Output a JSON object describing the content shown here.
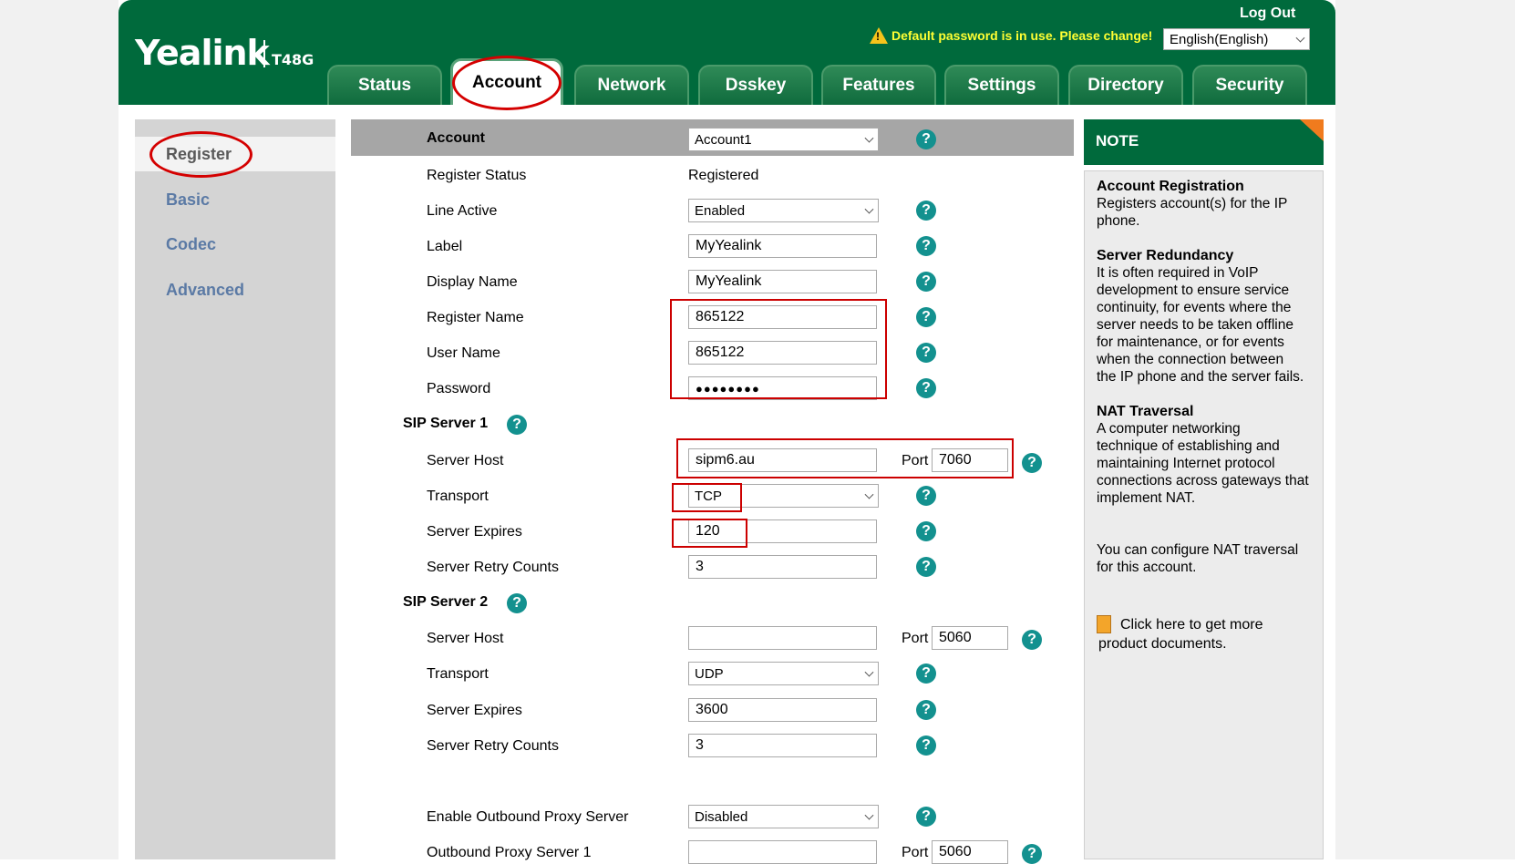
{
  "header": {
    "logo": "Yealink",
    "model": "T48G",
    "logout": "Log Out",
    "warning": "Default password is in use. Please change!",
    "language": "English(English)"
  },
  "tabs": [
    "Status",
    "Account",
    "Network",
    "Dsskey",
    "Features",
    "Settings",
    "Directory",
    "Security"
  ],
  "active_tab": "Account",
  "sidebar": {
    "items": [
      "Register",
      "Basic",
      "Codec",
      "Advanced"
    ],
    "active": "Register"
  },
  "form": {
    "account": {
      "label": "Account",
      "value": "Account1"
    },
    "register_status": {
      "label": "Register Status",
      "value": "Registered"
    },
    "line_active": {
      "label": "Line Active",
      "value": "Enabled"
    },
    "label_field": {
      "label": "Label",
      "value": "MyYealink"
    },
    "display_name": {
      "label": "Display Name",
      "value": "MyYealink"
    },
    "register_name": {
      "label": "Register Name",
      "value": "865122"
    },
    "user_name": {
      "label": "User Name",
      "value": "865122"
    },
    "password": {
      "label": "Password",
      "value": "●●●●●●●●"
    },
    "sip1": {
      "title": "SIP Server 1",
      "host_label": "Server Host",
      "host": "sipm6.au",
      "port_label": "Port",
      "port": "7060",
      "transport_label": "Transport",
      "transport": "TCP",
      "expires_label": "Server Expires",
      "expires": "120",
      "retry_label": "Server Retry Counts",
      "retry": "3"
    },
    "sip2": {
      "title": "SIP Server 2",
      "host_label": "Server Host",
      "host": "",
      "port_label": "Port",
      "port": "5060",
      "transport_label": "Transport",
      "transport": "UDP",
      "expires_label": "Server Expires",
      "expires": "3600",
      "retry_label": "Server Retry Counts",
      "retry": "3"
    },
    "outbound": {
      "label": "Enable Outbound Proxy Server",
      "value": "Disabled"
    },
    "outbound1": {
      "label": "Outbound Proxy Server 1",
      "value": "",
      "port_label": "Port",
      "port": "5060"
    }
  },
  "note": {
    "title": "NOTE",
    "sections": [
      {
        "title": "Account Registration",
        "lines": [
          "Registers account(s) for the IP",
          "phone."
        ]
      },
      {
        "title": "Server Redundancy",
        "lines": [
          "It is often required in VoIP",
          "development to ensure service",
          "continuity, for events where the",
          "server needs to be taken offline",
          "for maintenance, or for events",
          "when the connection between",
          "the IP phone and the server fails."
        ]
      },
      {
        "title": "NAT Traversal",
        "lines": [
          "A computer networking",
          "technique of establishing and",
          "maintaining Internet protocol",
          "connections across gateways that",
          "implement NAT."
        ]
      }
    ],
    "nat_config": [
      "You can configure NAT traversal",
      "for this account."
    ],
    "docs": [
      "Click here to get more",
      "product documents."
    ]
  },
  "colors": {
    "header_green": "#006a3c",
    "help_teal": "#13918f",
    "highlight_red": "#cc0000",
    "warning_yellow": "#ffff33"
  }
}
